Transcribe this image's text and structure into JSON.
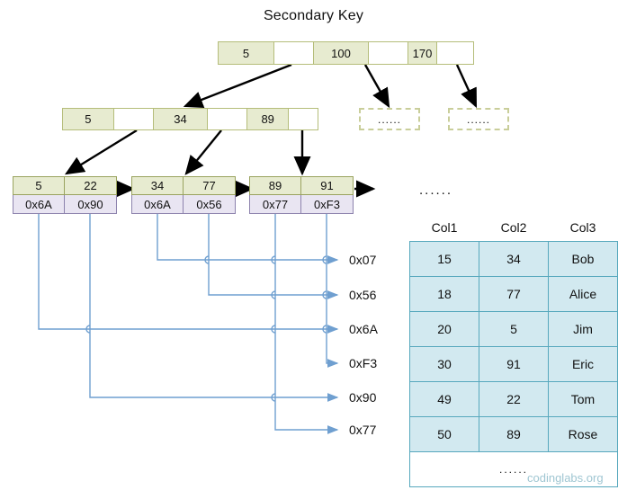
{
  "title": "Secondary Key",
  "tree": {
    "root": {
      "cells": [
        "5",
        "",
        "100",
        "",
        "170",
        ""
      ]
    },
    "internal": {
      "cells": [
        "5",
        "",
        "34",
        "",
        "89",
        ""
      ]
    },
    "leaves": [
      {
        "keys": [
          "5",
          "22"
        ],
        "pointers": [
          "0x6A",
          "0x90"
        ]
      },
      {
        "keys": [
          "34",
          "77"
        ],
        "pointers": [
          "0x6A",
          "0x56"
        ]
      },
      {
        "keys": [
          "89",
          "91"
        ],
        "pointers": [
          "0x77",
          "0xF3"
        ]
      }
    ],
    "placeholders": [
      "......",
      "......"
    ]
  },
  "addresses": [
    "0x07",
    "0x56",
    "0x6A",
    "0xF3",
    "0x90",
    "0x77"
  ],
  "table": {
    "ellipsis_above": "......",
    "headers": [
      "Col1",
      "Col2",
      "Col3"
    ],
    "rows": [
      [
        "15",
        "34",
        "Bob"
      ],
      [
        "18",
        "77",
        "Alice"
      ],
      [
        "20",
        "5",
        "Jim"
      ],
      [
        "30",
        "91",
        "Eric"
      ],
      [
        "49",
        "22",
        "Tom"
      ],
      [
        "50",
        "89",
        "Rose"
      ]
    ],
    "footer_ellipsis": "......"
  },
  "watermark": "codinglabs.org",
  "colors": {
    "key_fill": "#e7ebd0",
    "key_border": "#9aa35f",
    "pointer_fill": "#e9e5f2",
    "pointer_border": "#8d83ad",
    "table_fill": "#d2e9f0",
    "table_border": "#57a8bd",
    "connector": "#6f9fd0",
    "arrow_black": "#000000"
  }
}
